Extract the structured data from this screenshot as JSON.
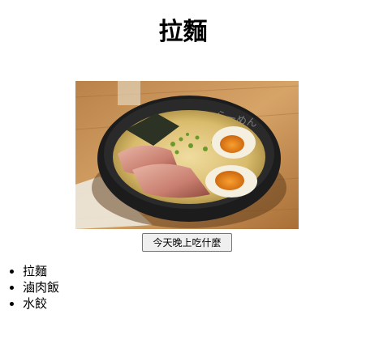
{
  "page": {
    "title": "拉麵"
  },
  "photo": {
    "subject": "ramen-bowl-photo",
    "bowl_lettering": "らーめん"
  },
  "button": {
    "label": "今天晚上吃什麼"
  },
  "food_list": {
    "items": [
      "拉麵",
      "滷肉飯",
      "水餃"
    ]
  }
}
